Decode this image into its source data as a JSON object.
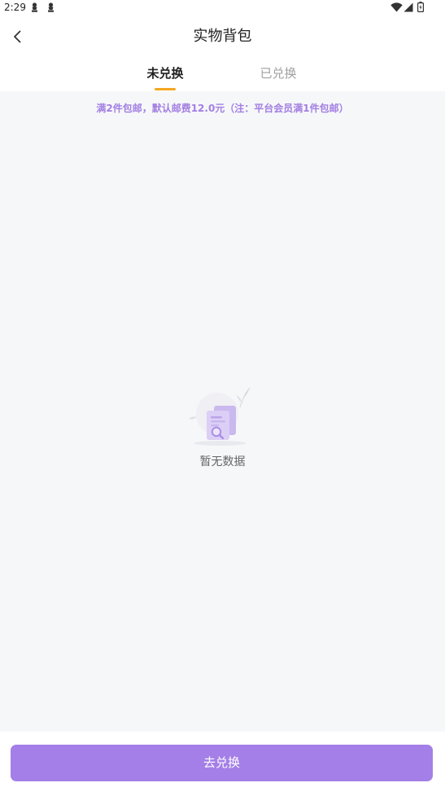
{
  "status_bar": {
    "time": "2:29",
    "icons": [
      "app-notification-icon",
      "app-notification-icon",
      "wifi-icon",
      "signal-icon",
      "battery-icon"
    ]
  },
  "header": {
    "title": "实物背包",
    "back_icon": "back-chevron-icon"
  },
  "tabs": [
    {
      "label": "未兑换",
      "active": true
    },
    {
      "label": "已兑换",
      "active": false
    }
  ],
  "notice": {
    "text": "满2件包邮，默认邮费12.0元（注：平台会员满1件包邮）"
  },
  "empty_state": {
    "icon": "empty-document-search-icon",
    "text": "暂无数据"
  },
  "footer": {
    "button_label": "去兑换"
  },
  "colors": {
    "accent": "#a47fe7",
    "notice_text": "#a37fe2",
    "tab_indicator": "#f5a623",
    "background": "#f6f7f9"
  }
}
